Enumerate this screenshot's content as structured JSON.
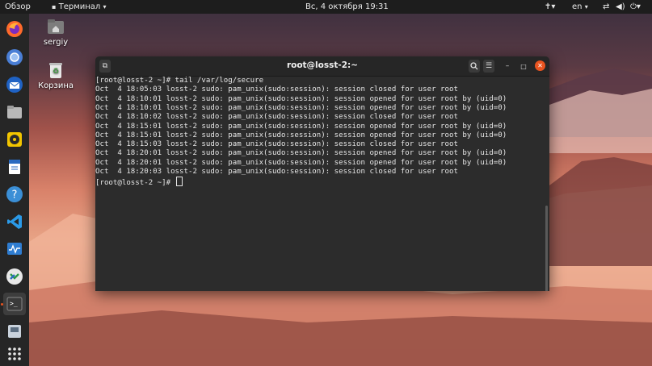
{
  "topbar": {
    "activities": "Обзор",
    "app_menu": "Терминал",
    "clock": "Вс, 4 октября  19:31",
    "lang": "en",
    "icons": [
      "accessibility-icon",
      "network-icon",
      "volume-icon",
      "power-icon"
    ]
  },
  "dock": {
    "apps": [
      "firefox-icon",
      "chromium-icon",
      "thunderbird-icon",
      "files-icon",
      "rhythmbox-icon",
      "writer-icon",
      "help-icon",
      "vscode-icon",
      "system-monitor-icon",
      "remote-desktop-icon",
      "terminal-icon",
      "media-writer-icon",
      "app-grid-icon"
    ]
  },
  "desktop": {
    "home_label": "sergiy",
    "trash_label": "Корзина"
  },
  "terminal": {
    "title": "root@losst-2:~",
    "lines": [
      "[root@losst-2 ~]# tail /var/log/secure",
      "Oct  4 18:05:03 losst-2 sudo: pam_unix(sudo:session): session closed for user root",
      "Oct  4 18:10:01 losst-2 sudo: pam_unix(sudo:session): session opened for user root by (uid=0)",
      "Oct  4 18:10:01 losst-2 sudo: pam_unix(sudo:session): session opened for user root by (uid=0)",
      "Oct  4 18:10:02 losst-2 sudo: pam_unix(sudo:session): session closed for user root",
      "Oct  4 18:15:01 losst-2 sudo: pam_unix(sudo:session): session opened for user root by (uid=0)",
      "Oct  4 18:15:01 losst-2 sudo: pam_unix(sudo:session): session opened for user root by (uid=0)",
      "Oct  4 18:15:03 losst-2 sudo: pam_unix(sudo:session): session closed for user root",
      "Oct  4 18:20:01 losst-2 sudo: pam_unix(sudo:session): session opened for user root by (uid=0)",
      "Oct  4 18:20:01 losst-2 sudo: pam_unix(sudo:session): session opened for user root by (uid=0)",
      "Oct  4 18:20:03 losst-2 sudo: pam_unix(sudo:session): session closed for user root"
    ],
    "prompt": "[root@losst-2 ~]# "
  },
  "colors": {
    "accent": "#e95420",
    "topbar_bg": "#1d1d1d",
    "terminal_bg": "#2c2c2c",
    "terminal_fg": "#e6e6e6"
  }
}
